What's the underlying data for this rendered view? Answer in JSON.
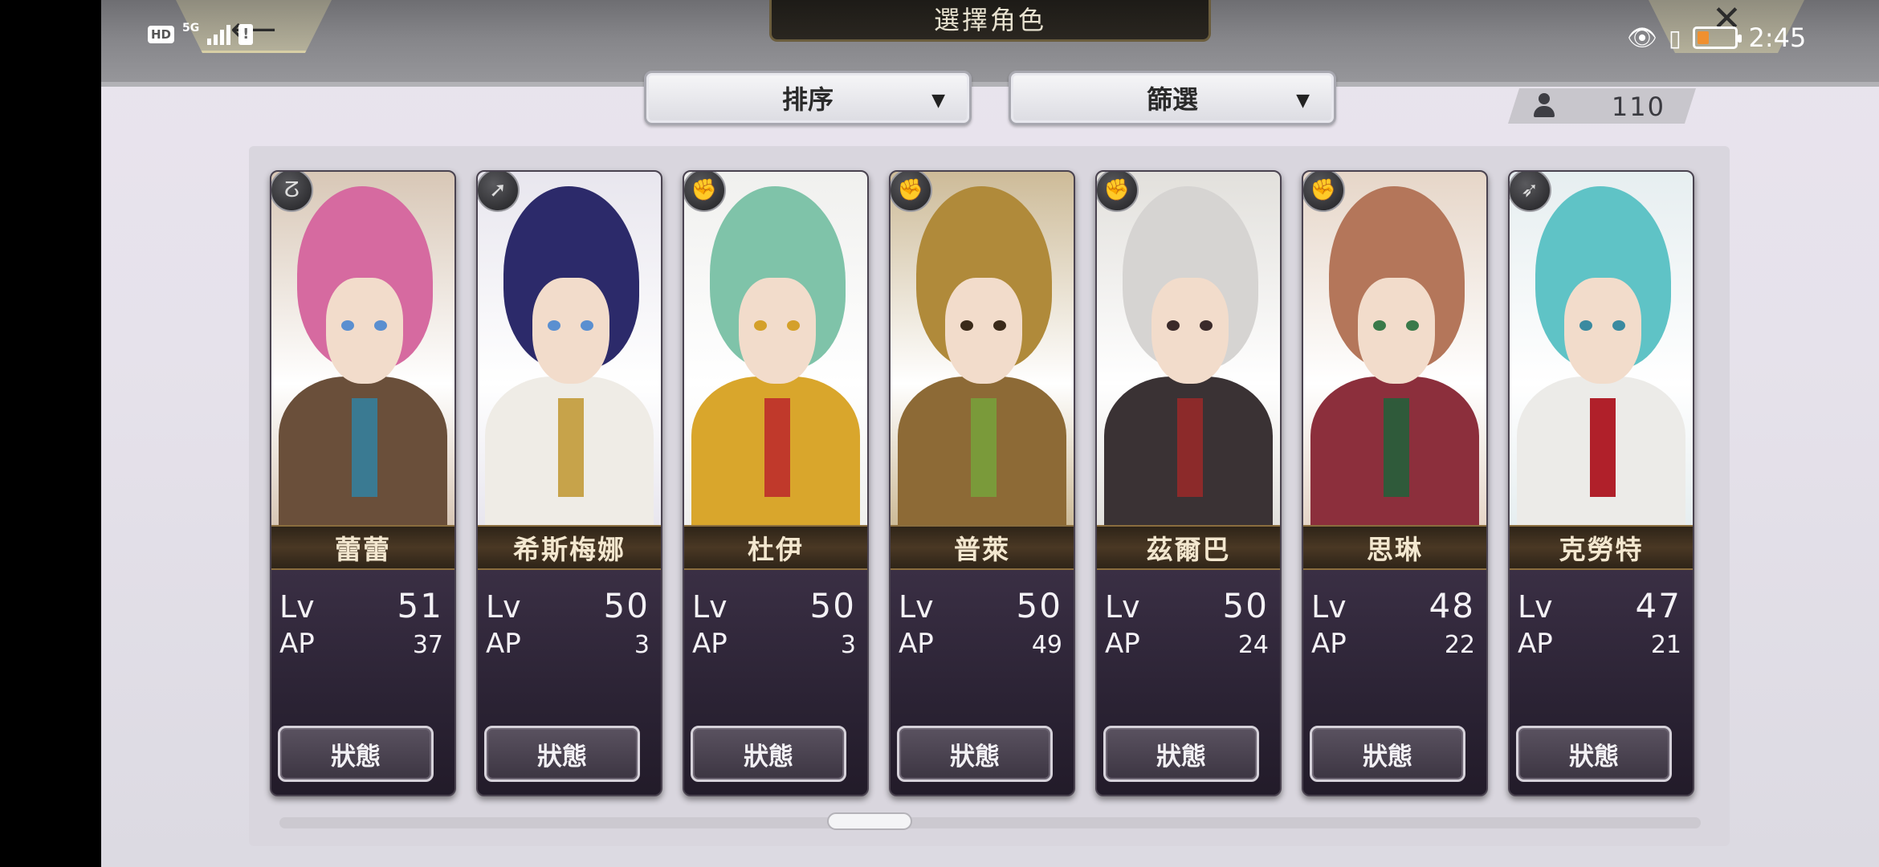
{
  "header": {
    "title": "選擇角色",
    "back_icon": "back-arrow-icon",
    "close_icon": "close-x-icon"
  },
  "status_bar": {
    "left": {
      "hd": "HD",
      "network": "5G"
    },
    "right": {
      "time": "2:45"
    }
  },
  "toolbar": {
    "sort_label": "排序",
    "filter_label": "篩選",
    "caret": "▼",
    "character_count": "110"
  },
  "characters": [
    {
      "name": "蕾蕾",
      "lv_label": "Lv",
      "lv": "51",
      "ap_label": "AP",
      "ap": "37",
      "status_label": "狀態",
      "class_icon": "staff-icon",
      "colors": {
        "bg": "#d8c7b6",
        "hair": "#d66aa0",
        "outfit": "#6a4f3a",
        "eye": "#5a8fd0",
        "accent": "#3a7a92"
      }
    },
    {
      "name": "希斯梅娜",
      "lv_label": "Lv",
      "lv": "50",
      "ap_label": "AP",
      "ap": "3",
      "status_label": "狀態",
      "class_icon": "spear-icon",
      "colors": {
        "bg": "#e8e6ee",
        "hair": "#2c2a6a",
        "outfit": "#efece6",
        "eye": "#5a8fd0",
        "accent": "#c7a34a"
      }
    },
    {
      "name": "杜伊",
      "lv_label": "Lv",
      "lv": "50",
      "ap_label": "AP",
      "ap": "3",
      "status_label": "狀態",
      "class_icon": "fist-icon",
      "colors": {
        "bg": "#f0f0ee",
        "hair": "#7fc3a9",
        "outfit": "#d9a62c",
        "eye": "#d4a02a",
        "accent": "#c0392b"
      }
    },
    {
      "name": "普萊",
      "lv_label": "Lv",
      "lv": "50",
      "ap_label": "AP",
      "ap": "49",
      "status_label": "狀態",
      "class_icon": "fist-icon",
      "colors": {
        "bg": "#cdbb98",
        "hair": "#b08a3a",
        "outfit": "#8d6a36",
        "eye": "#3a2a1a",
        "accent": "#7a9a3a"
      }
    },
    {
      "name": "茲爾巴",
      "lv_label": "Lv",
      "lv": "50",
      "ap_label": "AP",
      "ap": "24",
      "status_label": "狀態",
      "class_icon": "fist-icon",
      "colors": {
        "bg": "#e2e0dc",
        "hair": "#d6d4d2",
        "outfit": "#3a3234",
        "eye": "#3a2a2a",
        "accent": "#8c2a2a"
      }
    },
    {
      "name": "思琳",
      "lv_label": "Lv",
      "lv": "48",
      "ap_label": "AP",
      "ap": "22",
      "status_label": "狀態",
      "class_icon": "fist-icon",
      "colors": {
        "bg": "#e6d6c8",
        "hair": "#b4765a",
        "outfit": "#8c2f3c",
        "eye": "#3a7a4a",
        "accent": "#2f5a3a"
      }
    },
    {
      "name": "克勞特",
      "lv_label": "Lv",
      "lv": "47",
      "ap_label": "AP",
      "ap": "21",
      "status_label": "狀態",
      "class_icon": "bow-icon",
      "colors": {
        "bg": "#e6eef0",
        "hair": "#5fc3c6",
        "outfit": "#ecebe8",
        "eye": "#3a8aa0",
        "accent": "#b0202a"
      }
    }
  ],
  "scroll": {
    "position": 0.41
  }
}
